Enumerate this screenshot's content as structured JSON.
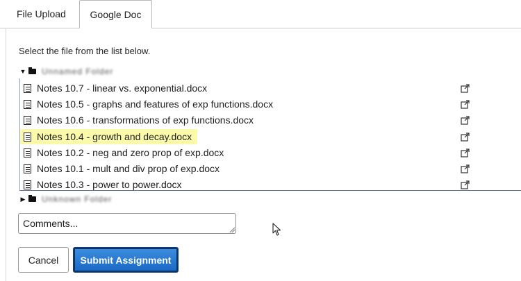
{
  "tabs": [
    {
      "label": "File Upload",
      "active": false
    },
    {
      "label": "Google Doc",
      "active": true
    }
  ],
  "instruction": "Select the file from the list below.",
  "folders": [
    {
      "name": "Unnamed Folder",
      "expanded": true
    },
    {
      "name": "Unknown Folder",
      "expanded": false
    }
  ],
  "files": [
    {
      "name": "Notes 10.7 - linear vs. exponential.docx",
      "selected": false
    },
    {
      "name": "Notes 10.5 - graphs and features of exp functions.docx",
      "selected": false
    },
    {
      "name": "Notes 10.6 - transformations of exp functions.docx",
      "selected": false
    },
    {
      "name": "Notes 10.4 - growth and decay.docx",
      "selected": true
    },
    {
      "name": "Notes 10.2 - neg and zero prop of exp.docx",
      "selected": false
    },
    {
      "name": "Notes 10.1 - mult and div prop of exp.docx",
      "selected": false
    },
    {
      "name": "Notes 10.3 - power to power.docx",
      "selected": false
    }
  ],
  "comments": {
    "placeholder": "Comments...",
    "value": ""
  },
  "buttons": {
    "cancel": "Cancel",
    "submit": "Submit Assignment"
  },
  "colors": {
    "selected_row": "#fafaaa",
    "submit_bg": "#1867c4",
    "list_border": "#5b6f99"
  }
}
